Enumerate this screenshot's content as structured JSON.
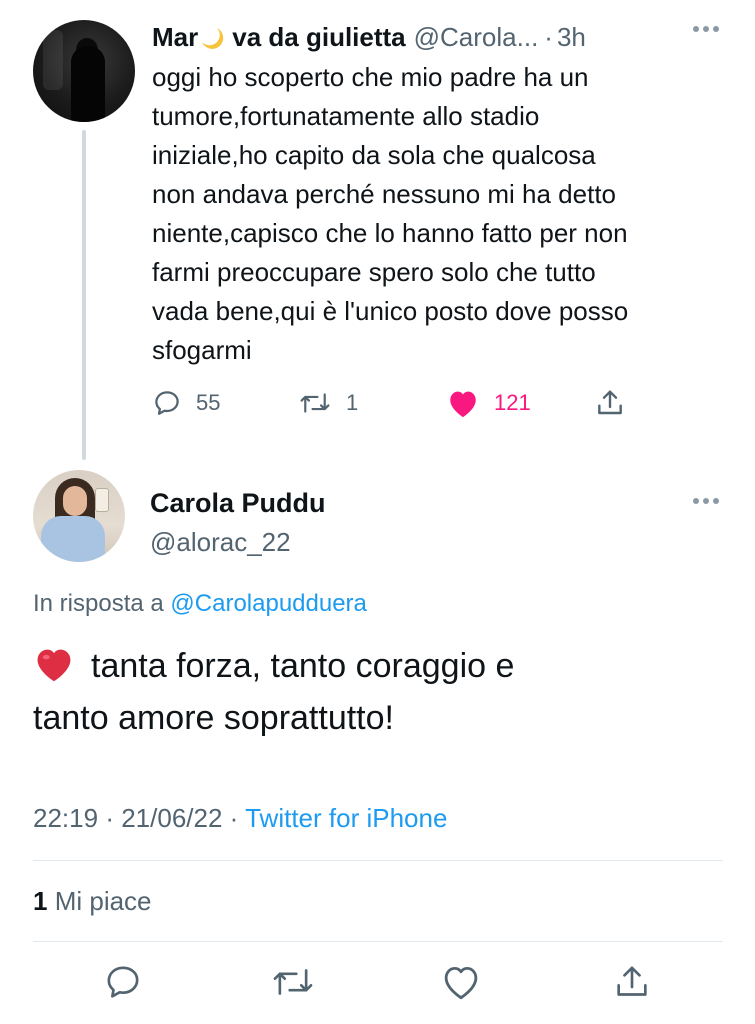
{
  "parent_tweet": {
    "name_part1": "Mar",
    "name_part2": "va da giulietta",
    "handle": "@Carola...",
    "separator": "·",
    "time": "3h",
    "text": "oggi ho scoperto che mio padre ha un\ntumore,fortunatamente allo stadio\niniziale,ho capito da sola che qualcosa\nnon andava perché nessuno mi ha detto\nniente,capisco che lo hanno fatto per non\nfarmi preoccupare spero solo che tutto\nvada bene,qui è l'unico posto dove posso\nsfogarmi",
    "replies": "55",
    "retweets": "1",
    "likes": "121",
    "liked": true
  },
  "main_tweet": {
    "name": "Carola Puddu",
    "handle": "@alorac_22",
    "reply_prefix": "In risposta a",
    "reply_mention": "@Carolapudduera",
    "text_line1": "tanta forza, tanto coraggio e",
    "text_line2": "tanto amore soprattutto!",
    "time": "22:19",
    "sep1": "·",
    "date": "21/06/22",
    "sep2": "·",
    "source": "Twitter for iPhone",
    "like_count": "1",
    "like_label": "Mi piace"
  },
  "colors": {
    "text": "#0f1419",
    "secondary": "#536471",
    "link": "#1d9bf0",
    "like": "#f91880",
    "divider": "#e1e8ed",
    "thread": "#cfd9de"
  },
  "icons": {
    "reply": "reply-icon",
    "retweet": "retweet-icon",
    "like": "heart-icon",
    "share": "share-icon",
    "more": "more-icon",
    "moon": "crescent-moon-icon",
    "heart_emoji": "red-heart-emoji"
  }
}
